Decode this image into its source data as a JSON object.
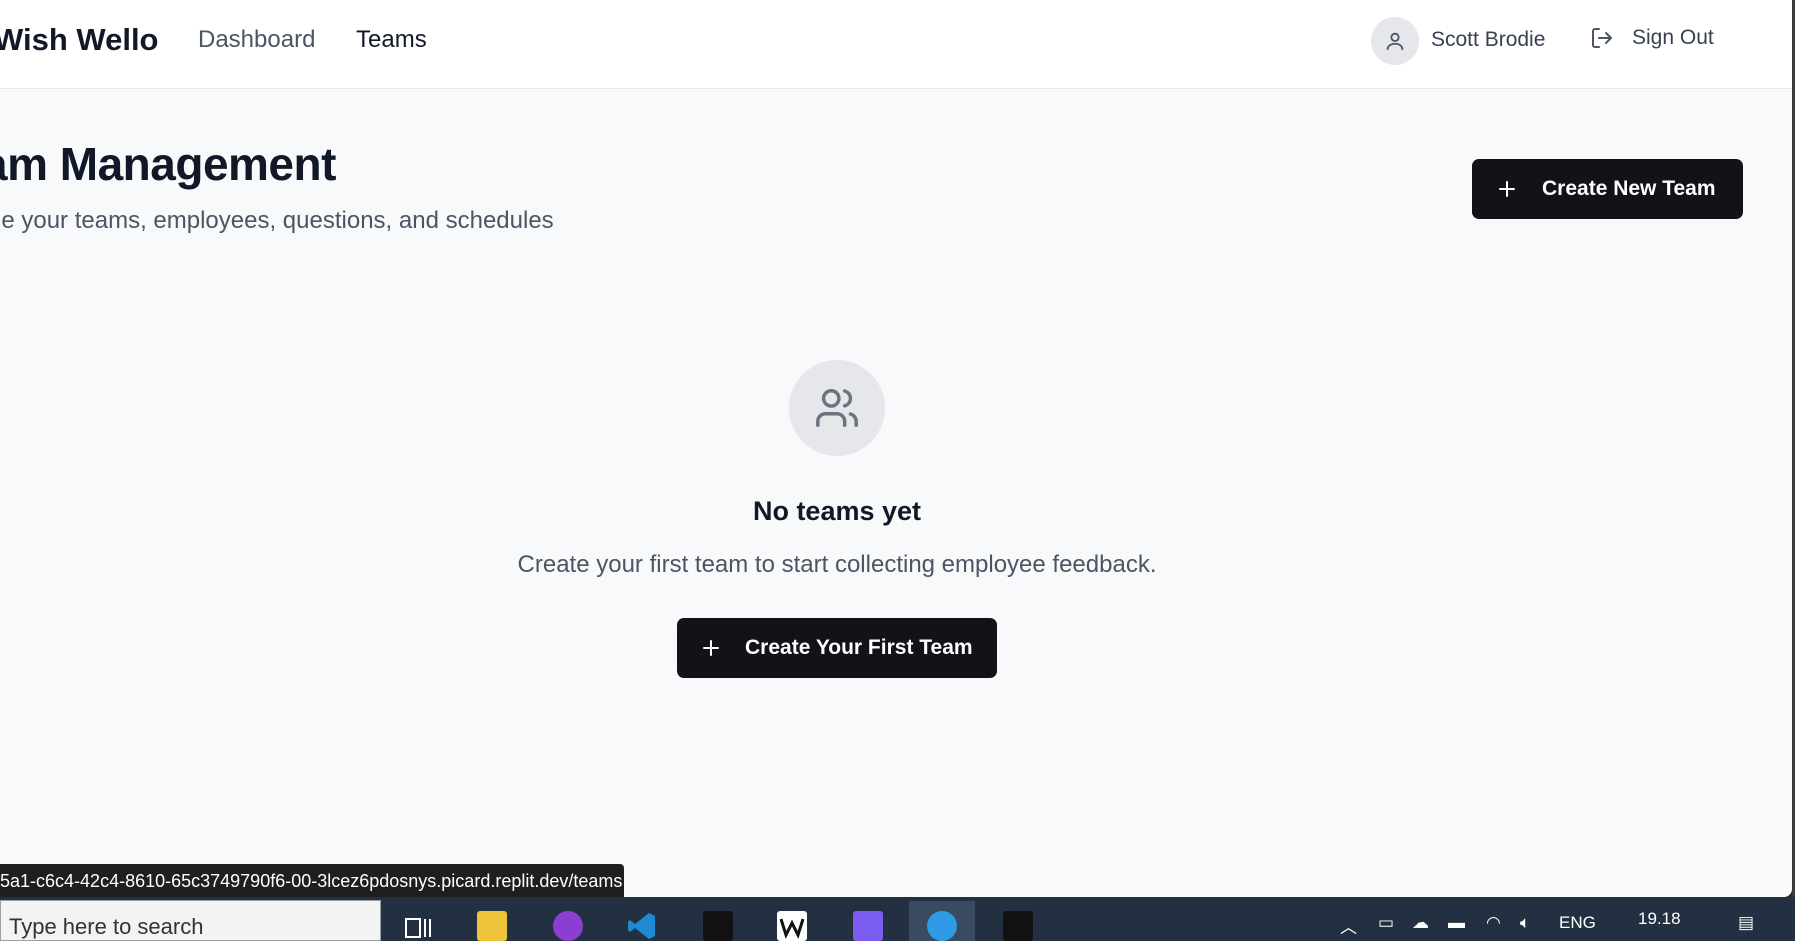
{
  "app": {
    "brand": "Wish Wello"
  },
  "nav": {
    "dashboard": "Dashboard",
    "teams": "Teams"
  },
  "user": {
    "name": "Scott Brodie",
    "sign_out": "Sign Out"
  },
  "page": {
    "title": "am Management",
    "subtitle": "ge your teams, employees, questions, and schedules",
    "create_new_team": "Create New Team"
  },
  "empty_state": {
    "title": "No teams yet",
    "subtitle": "Create your first team to start collecting employee feedback.",
    "create_first_team": "Create Your First Team"
  },
  "status_bar": {
    "url": "5a1-c6c4-42c4-8610-65c3749790f6-00-3lcez6pdosnys.picard.replit.dev/teams"
  },
  "taskbar": {
    "search_placeholder": "Type here to search",
    "language": "ENG",
    "time": "19.18",
    "apps": [
      "task-view",
      "file-explorer",
      "github-desktop",
      "vscode",
      "app-cube",
      "wello-app",
      "copilot",
      "edge",
      "app-cube-2"
    ]
  },
  "colors": {
    "primary_button": "#111318",
    "page_bg": "#f8f9fa",
    "taskbar": "#233042"
  }
}
